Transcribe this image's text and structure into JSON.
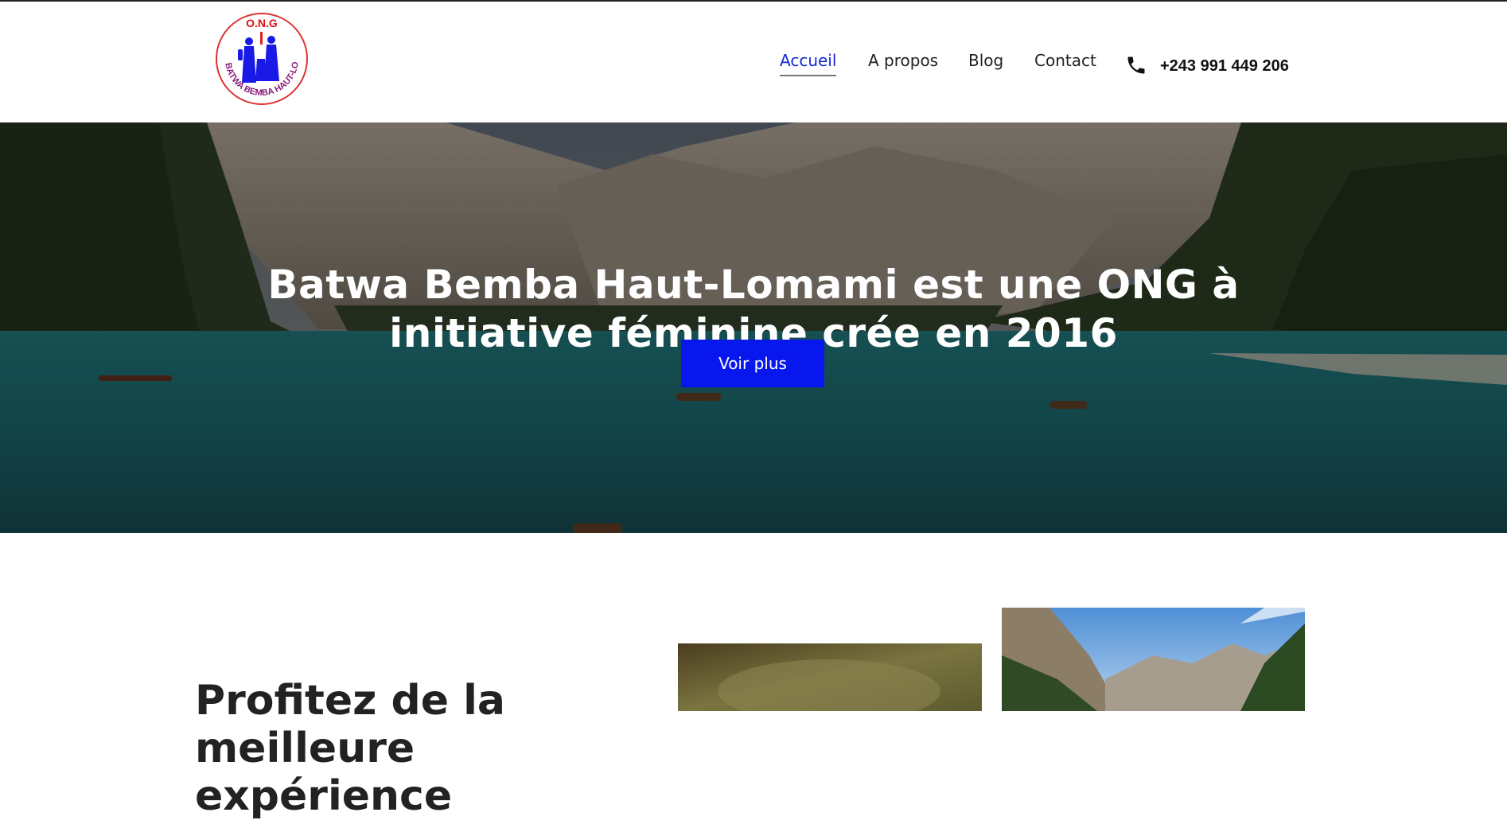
{
  "logo": {
    "top_text": "O.N.G",
    "ring_text": "BATWA BEMBA HAUT-LOMAMI"
  },
  "nav": {
    "items": [
      {
        "label": "Accueil",
        "active": true
      },
      {
        "label": "A propos",
        "active": false
      },
      {
        "label": "Blog",
        "active": false
      },
      {
        "label": "Contact",
        "active": false
      }
    ],
    "phone_icon": "phone-icon",
    "phone": "+243 991 449 206"
  },
  "hero": {
    "title": "Batwa Bemba Haut-Lomami est une ONG à initiative féminine crée en 2016",
    "button": "Voir plus"
  },
  "section": {
    "title": "Profitez de la meilleure expérience"
  },
  "colors": {
    "accent": "#0717ee",
    "nav_active": "#1428d6",
    "text": "#222222"
  }
}
